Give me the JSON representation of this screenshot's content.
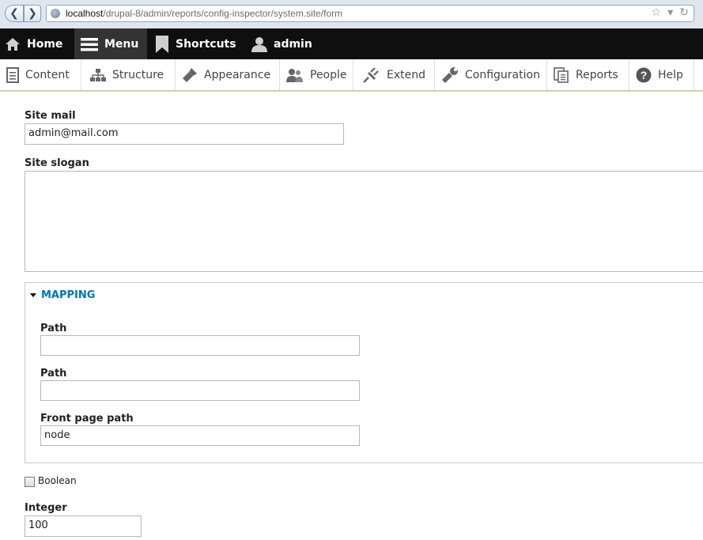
{
  "browser": {
    "url_host": "localhost",
    "url_path": "/drupal-8/admin/reports/config-inspector/system.site/form"
  },
  "toolbar": {
    "items": [
      {
        "label": "Home",
        "icon": "home-icon"
      },
      {
        "label": "Menu",
        "icon": "menu-icon"
      },
      {
        "label": "Shortcuts",
        "icon": "bookmark-icon"
      },
      {
        "label": "admin",
        "icon": "user-icon"
      }
    ]
  },
  "tray": {
    "items": [
      {
        "label": "Content",
        "icon": "content-icon"
      },
      {
        "label": "Structure",
        "icon": "structure-icon"
      },
      {
        "label": "Appearance",
        "icon": "appearance-icon"
      },
      {
        "label": "People",
        "icon": "people-icon"
      },
      {
        "label": "Extend",
        "icon": "extend-icon"
      },
      {
        "label": "Configuration",
        "icon": "wrench-icon"
      },
      {
        "label": "Reports",
        "icon": "reports-icon"
      },
      {
        "label": "Help",
        "icon": "help-icon"
      }
    ]
  },
  "form": {
    "site_mail": {
      "label": "Site mail",
      "value": "admin@mail.com"
    },
    "site_slogan": {
      "label": "Site slogan",
      "value": ""
    },
    "mapping": {
      "legend": "MAPPING",
      "fields": [
        {
          "label": "Path",
          "value": ""
        },
        {
          "label": "Path",
          "value": ""
        },
        {
          "label": "Front page path",
          "value": "node"
        }
      ]
    },
    "boolean": {
      "label": "Boolean",
      "checked": false
    },
    "integer": {
      "label": "Integer",
      "value": "100"
    }
  },
  "colors": {
    "toolbar_bg": "#0f0f0f",
    "menu_active_bg": "#333333",
    "legend_link": "#0074bd"
  }
}
